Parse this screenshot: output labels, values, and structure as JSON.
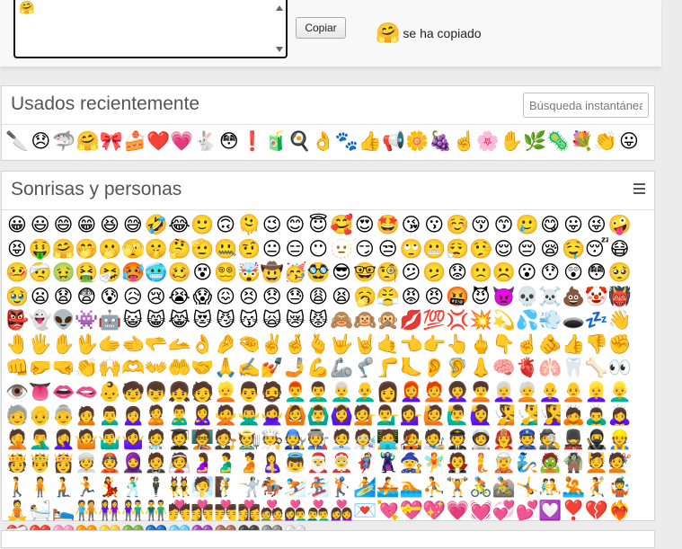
{
  "copy_bar": {
    "textarea_value": "🤗",
    "copy_button_label": "Copiar",
    "copied_emoji": "🤗",
    "copied_text": "se ha copiado"
  },
  "recent": {
    "title": "Usados recientemente",
    "search_placeholder": "Búsqueda instantánea",
    "emojis": [
      "🔪",
      "😞",
      "🦈",
      "🤗",
      "🎀",
      "🍰",
      "❤️",
      "💗",
      "🐇",
      "😳",
      "❗",
      "🧃",
      "🍳",
      "👌",
      "🐾",
      "👍",
      "📢",
      "🌼",
      "🍇",
      "☝️",
      "🌸",
      "✋",
      "🌿",
      "🦠",
      "💐",
      "👏",
      "😛"
    ]
  },
  "smileys": {
    "title": "Sonrisas y personas",
    "emojis": [
      "😀",
      "😃",
      "😄",
      "😁",
      "😆",
      "😅",
      "🤣",
      "😂",
      "🙂",
      "🙃",
      "🫠",
      "😉",
      "😊",
      "😇",
      "🥰",
      "😍",
      "🤩",
      "😘",
      "😗",
      "☺️",
      "😚",
      "😙",
      "🥲",
      "😋",
      "😛",
      "😜",
      "🤪",
      "😝",
      "🤑",
      "🤗",
      "🤭",
      "🫢",
      "🫣",
      "🤫",
      "🤔",
      "🫡",
      "🤐",
      "🤨",
      "😐",
      "😑",
      "😶",
      "🫥",
      "😏",
      "😒",
      "🙄",
      "😬",
      "😮‍💨",
      "🤥",
      "😌",
      "😔",
      "😪",
      "🤤",
      "😴",
      "😷",
      "🤒",
      "🤕",
      "🤢",
      "🤮",
      "🤧",
      "🥵",
      "🥶",
      "🥴",
      "😵",
      "😵‍💫",
      "🤯",
      "🤠",
      "🥳",
      "🥸",
      "😎",
      "🤓",
      "🧐",
      "😕",
      "🫤",
      "😟",
      "🙁",
      "☹️",
      "😮",
      "😯",
      "😲",
      "😳",
      "🥺",
      "🥹",
      "😦",
      "😧",
      "😨",
      "😰",
      "😥",
      "😢",
      "😭",
      "😱",
      "😖",
      "😣",
      "😞",
      "😓",
      "😩",
      "😫",
      "🥱",
      "😤",
      "😡",
      "😠",
      "🤬",
      "😈",
      "👿",
      "💀",
      "☠️",
      "💩",
      "🤡",
      "👹",
      "👺",
      "👻",
      "👽",
      "👾",
      "🤖",
      "😺",
      "😸",
      "😹",
      "😻",
      "😼",
      "😽",
      "🙀",
      "😿",
      "😾",
      "🙈",
      "🙉",
      "🙊",
      "💋",
      "💯",
      "💢",
      "💥",
      "💫",
      "💦",
      "💨",
      "🕳️",
      "💤",
      "👋",
      "🤚",
      "🖐️",
      "✋",
      "🖖",
      "🫱",
      "🫲",
      "🫳",
      "🫴",
      "👌",
      "🤌",
      "🤏",
      "✌️",
      "🤞",
      "🫰",
      "🤟",
      "🤘",
      "🤙",
      "👈",
      "👉",
      "👆",
      "🖕",
      "👇",
      "☝️",
      "🫵",
      "👍",
      "👎",
      "✊",
      "👊",
      "🤛",
      "🤜",
      "👏",
      "🙌",
      "🫶",
      "👐",
      "🤲",
      "🤝",
      "🙏",
      "✍️",
      "💅",
      "🤳",
      "💪",
      "🦾",
      "🦿",
      "🦵",
      "🦶",
      "👂",
      "🦻",
      "👃",
      "🧠",
      "🫀",
      "🫁",
      "🦷",
      "🦴",
      "👀",
      "👁️",
      "👅",
      "👄",
      "🫦",
      "👶",
      "🧒",
      "👦",
      "👧",
      "🧑",
      "👱",
      "👨",
      "🧔",
      "👨‍🦰",
      "👨‍🦱",
      "👨‍🦳",
      "👨‍🦲",
      "👩",
      "👩‍🦰",
      "🧑‍🦰",
      "👩‍🦱",
      "🧑‍🦱",
      "👩‍🦳",
      "🧑‍🦳",
      "👩‍🦲",
      "🧑‍🦲",
      "👱‍♀️",
      "👱‍♂️",
      "🧓",
      "👴",
      "👵",
      "🙍",
      "🙍‍♂️",
      "🙍‍♀️",
      "🙎",
      "🙎‍♂️",
      "🙎‍♀️",
      "🙅",
      "🙅‍♂️",
      "🙅‍♀️",
      "🙆",
      "🙆‍♂️",
      "🙆‍♀️",
      "💁",
      "💁‍♂️",
      "💁‍♀️",
      "🙋",
      "🙋‍♂️",
      "🙋‍♀️",
      "🧏",
      "🧏‍♂️",
      "🧏‍♀️",
      "🙇",
      "🙇‍♂️",
      "🙇‍♀️",
      "🤦",
      "🤦‍♂️",
      "🤦‍♀️",
      "🤷",
      "🤷‍♂️",
      "🤷‍♀️",
      "🧑‍⚕️",
      "🧑‍🎓",
      "🧑‍🏫",
      "🧑‍⚖️",
      "🧑‍🌾",
      "🧑‍🍳",
      "🧑‍🔧",
      "🧑‍🏭",
      "🧑‍💼",
      "🧑‍🔬",
      "🧑‍💻",
      "🧑‍🎤",
      "🧑‍🎨",
      "🧑‍✈️",
      "🧑‍🚀",
      "🧑‍🚒",
      "👮",
      "🕵️",
      "💂",
      "🥷",
      "👷",
      "🫅",
      "🤴",
      "👸",
      "👳",
      "👲",
      "🧕",
      "🤵",
      "👰",
      "🤰",
      "🫃",
      "🫄",
      "🤱",
      "👼",
      "🎅",
      "🤶",
      "🦸",
      "🦹",
      "🧙",
      "🧚",
      "🧛",
      "🧜",
      "🧝",
      "🧞",
      "🧟",
      "🧌",
      "💆",
      "💇",
      "🚶",
      "🧍",
      "🧎",
      "🏃",
      "💃",
      "🕺",
      "🕴️",
      "👯",
      "🧖",
      "🧗",
      "🤺",
      "🏇",
      "⛷️",
      "🏂",
      "🏌️",
      "🏄",
      "🚣",
      "🏊",
      "⛹️",
      "🏋️",
      "🚴",
      "🚵",
      "🤸",
      "🤼",
      "🤽",
      "🤾",
      "🤹",
      "🧘",
      "🛀",
      "🛌",
      "🧑‍🤝‍🧑",
      "👭",
      "👫",
      "👬",
      "💏",
      "👩‍❤️‍💋‍👨",
      "👨‍❤️‍💋‍👨",
      "👩‍❤️‍💋‍👩",
      "💑",
      "👩‍❤️‍👨",
      "👨‍❤️‍👨",
      "👩‍❤️‍👩",
      "💌",
      "💘",
      "💝",
      "💖",
      "💗",
      "💓",
      "💞",
      "💕",
      "💟",
      "❣️",
      "💔",
      "❤️‍🔥",
      "❤️‍🩹",
      "❤️",
      "🩷",
      "🧡",
      "💛",
      "💚",
      "💙",
      "🩵",
      "💜",
      "🤎",
      "🖤",
      "🩶",
      "🤍"
    ]
  }
}
